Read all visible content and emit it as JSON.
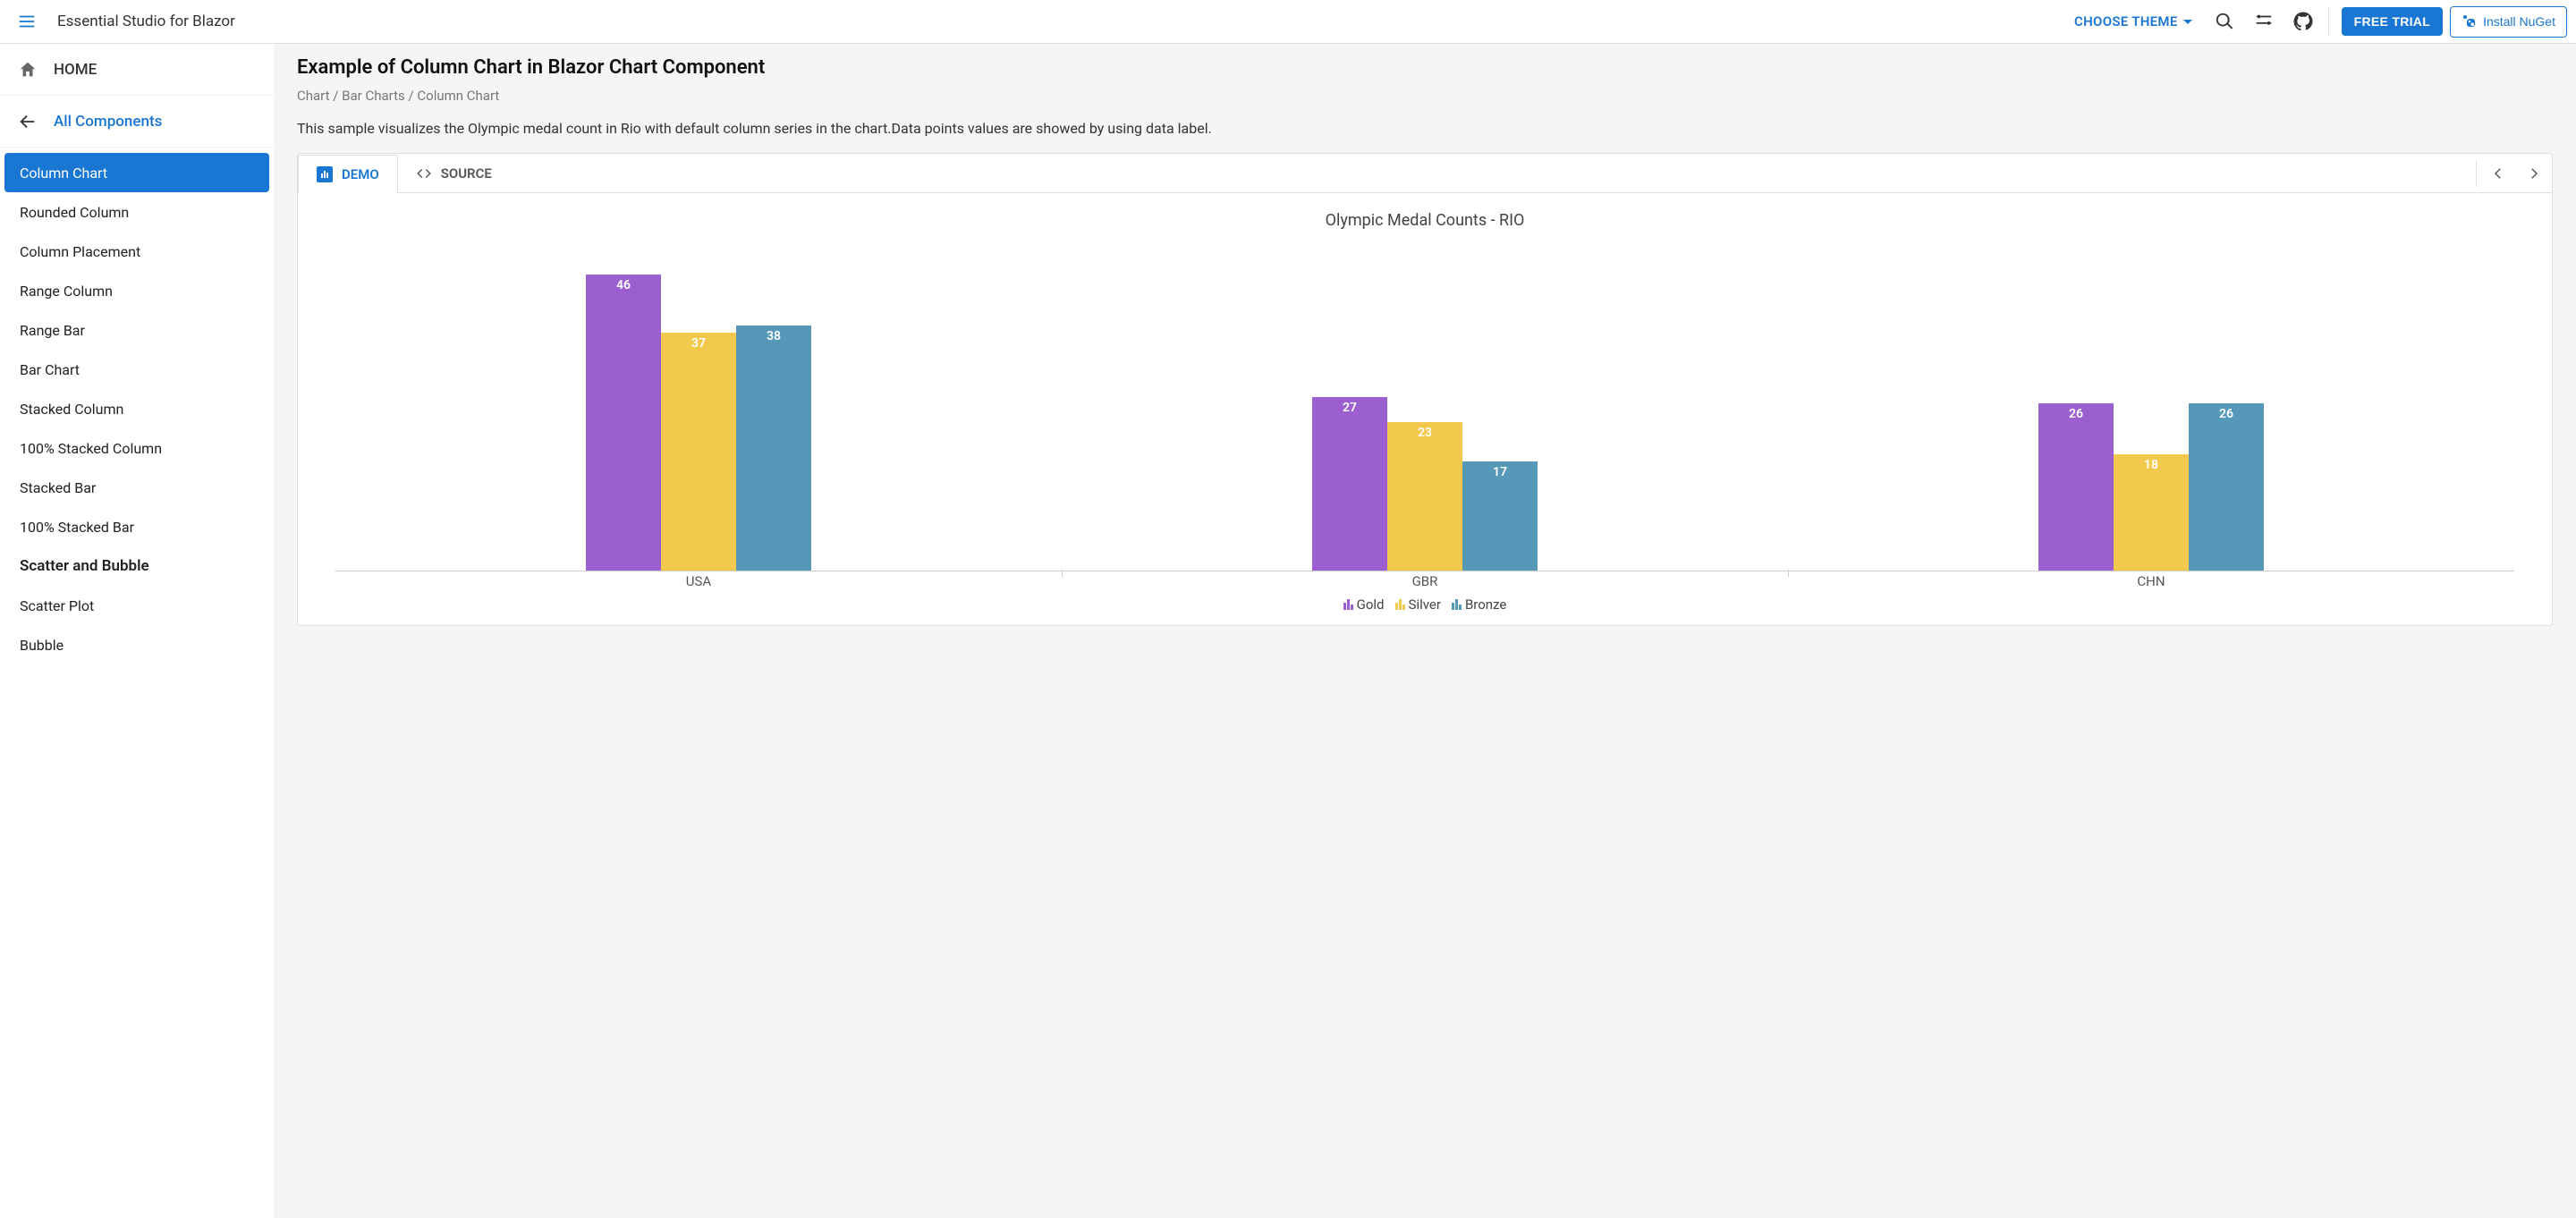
{
  "header": {
    "app_title": "Essential Studio for Blazor",
    "theme_label": "CHOOSE THEME",
    "free_trial_label": "FREE TRIAL",
    "nuget_label": "Install NuGet"
  },
  "sidebar": {
    "home_label": "HOME",
    "all_components_label": "All Components",
    "items": [
      "Column Chart",
      "Rounded Column",
      "Column Placement",
      "Range Column",
      "Range Bar",
      "Bar Chart",
      "Stacked Column",
      "100% Stacked Column",
      "Stacked Bar",
      "100% Stacked Bar"
    ],
    "group_label": "Scatter and Bubble",
    "group_items": [
      "Scatter Plot",
      "Bubble"
    ],
    "active_index": 0
  },
  "main": {
    "title": "Example of Column Chart in Blazor Chart Component",
    "breadcrumb": "Chart / Bar Charts / Column Chart",
    "description": "This sample visualizes the Olympic medal count in Rio with default column series in the chart.Data points values are showed by using data label.",
    "tabs": {
      "demo": "DEMO",
      "source": "SOURCE"
    }
  },
  "chart_data": {
    "type": "bar",
    "title": "Olympic Medal Counts - RIO",
    "categories": [
      "USA",
      "GBR",
      "CHN"
    ],
    "series": [
      {
        "name": "Gold",
        "color": "#9b5fcf",
        "values": [
          46,
          27,
          26
        ]
      },
      {
        "name": "Silver",
        "color": "#f2c94c",
        "values": [
          37,
          23,
          18
        ]
      },
      {
        "name": "Bronze",
        "color": "#5698b8",
        "values": [
          38,
          17,
          26
        ]
      }
    ],
    "ylim": [
      0,
      50
    ],
    "xlabel": "",
    "ylabel": ""
  }
}
